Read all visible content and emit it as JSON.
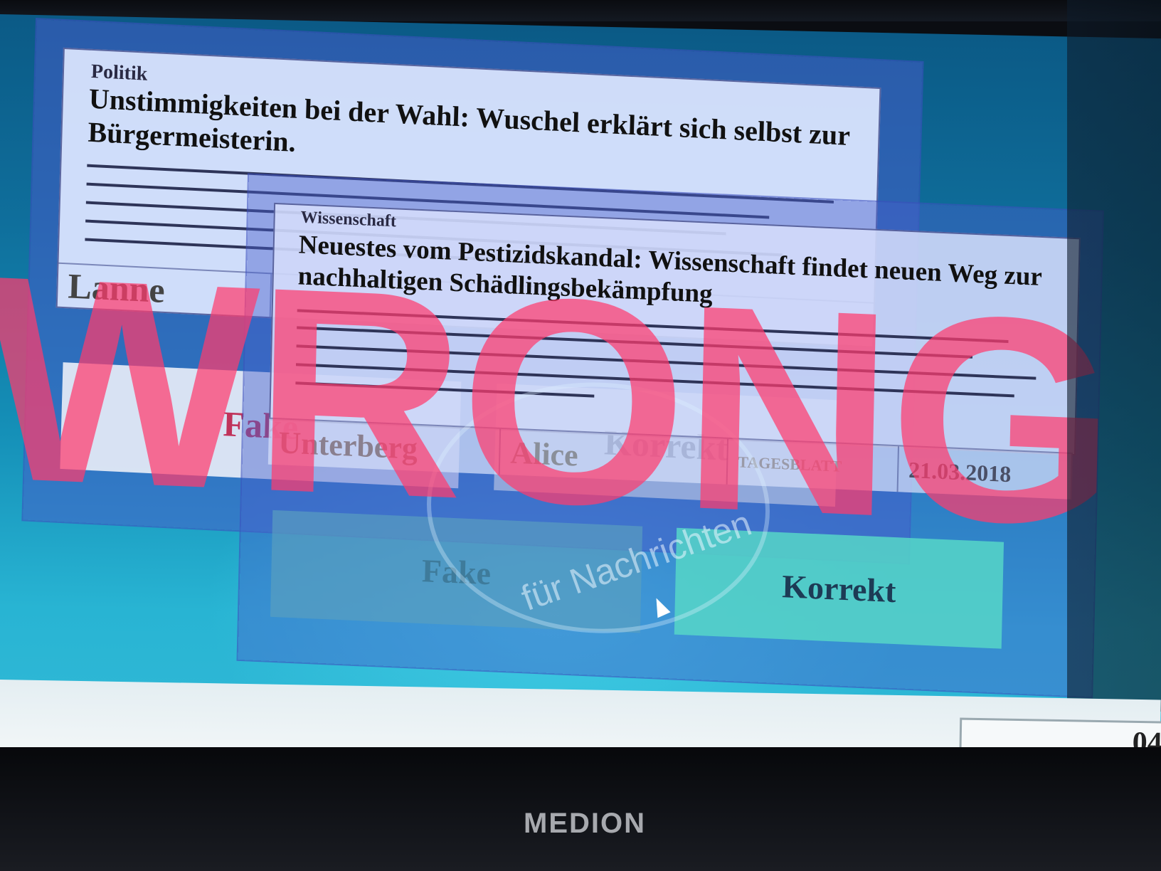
{
  "back_article": {
    "category": "Politik",
    "headline": "Unstimmigkeiten bei der Wahl: Wuschel erklärt sich selbst zur Bürgermeisterin.",
    "author_fragment": "Lanne",
    "button_fake": "Fake",
    "button_correct": "Korrekt"
  },
  "front_article": {
    "category": "Wissenschaft",
    "headline": "Neuestes vom Pestizidskandal: Wissenschaft findet neuen Weg zur nachhaltigen Schädlingsbekämpfung",
    "author_last": "Unterberg",
    "author_first": "Alice",
    "publisher": "TAGESBLATT",
    "date": "21.03.2018"
  },
  "buttons": {
    "fake_label": "Fake",
    "correct_label": "Korrekt"
  },
  "stamp": {
    "text": "WRONG",
    "color": "#ff3c6e"
  },
  "watermark": {
    "text": "für Nachrichten"
  },
  "taskbar": {
    "clock_fragment": "04"
  },
  "bezel": {
    "brand": "MEDION"
  }
}
